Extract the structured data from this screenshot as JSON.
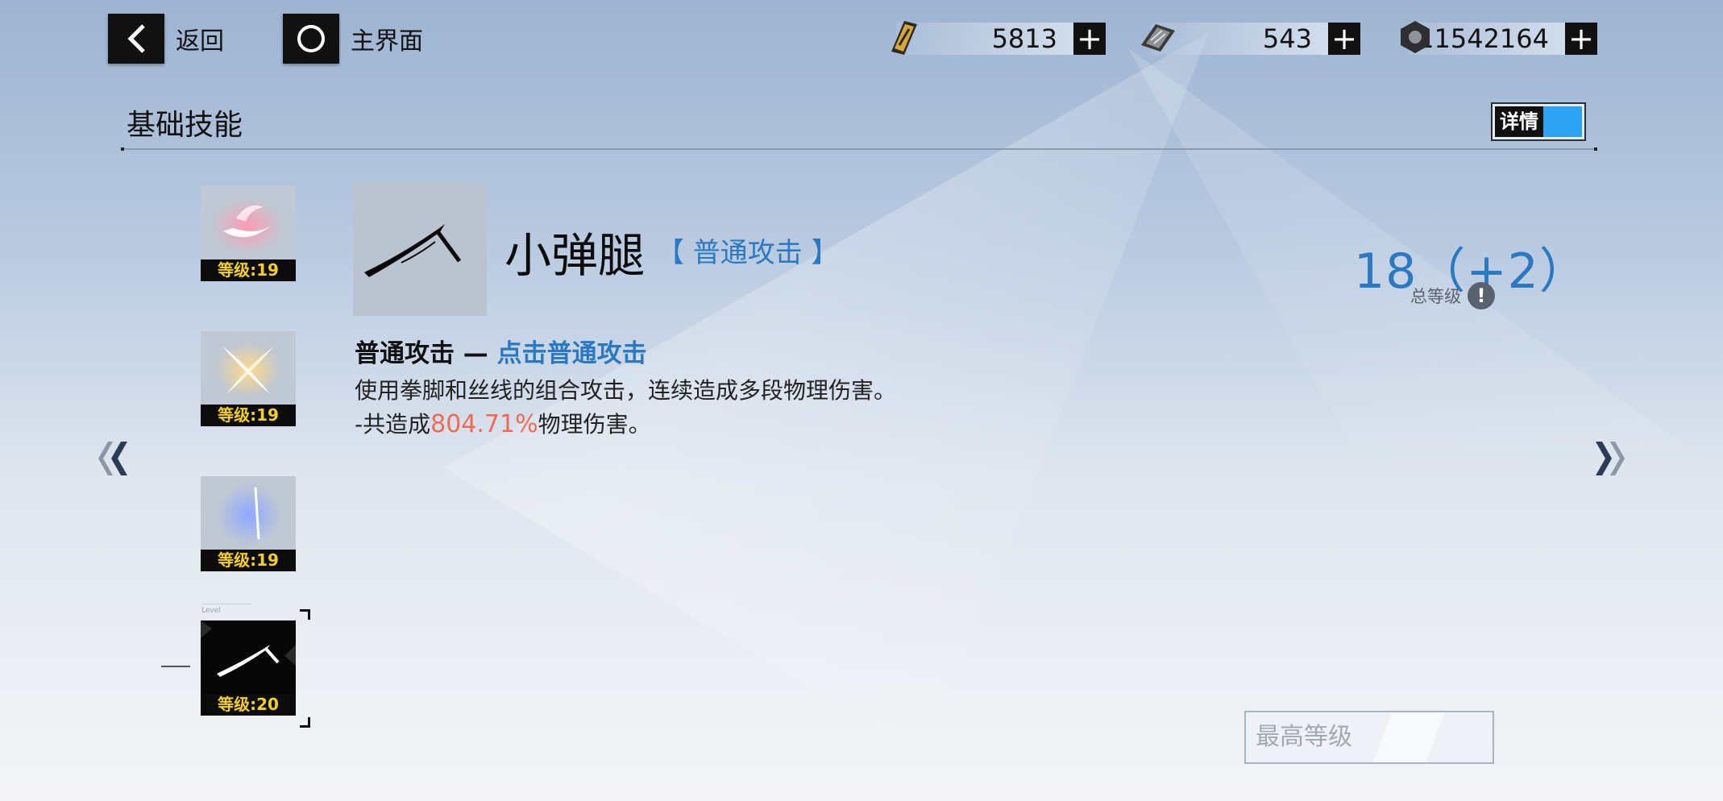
{
  "nav": {
    "back_label": "返回",
    "home_label": "主界面"
  },
  "resources": [
    {
      "icon": "gold-card-icon",
      "value": "5813"
    },
    {
      "icon": "chip-icon",
      "value": "543"
    },
    {
      "icon": "hex-nut-icon",
      "value": "11542164"
    }
  ],
  "section": {
    "title": "基础技能",
    "detail_label": "详情"
  },
  "skills": [
    {
      "level": "等级:19",
      "icon": "pink-burst-icon"
    },
    {
      "level": "等级:19",
      "icon": "cross-slash-icon"
    },
    {
      "level": "等级:19",
      "icon": "blue-crescent-icon"
    },
    {
      "level": "等级:20",
      "icon": "kick-icon",
      "selected": true,
      "tag": "Level"
    }
  ],
  "selected_skill": {
    "name": "小弹腿",
    "type": "【 普通攻击 】",
    "desc_head": "普通攻击 —",
    "desc_action": "点击普通攻击",
    "desc_line1": "使用拳脚和丝线的组合攻击，连续造成多段物理伤害。",
    "desc_line2_prefix": "-共造成",
    "desc_line2_value": "804.71%",
    "desc_line2_suffix": "物理伤害。",
    "total_level": "18（+2）",
    "total_level_label": "总等级"
  },
  "footer": {
    "max_level_label": "最高等级"
  },
  "colors": {
    "accent_blue": "#2a79c2",
    "damage_red": "#ef6a55",
    "level_yellow": "#f5d020"
  }
}
